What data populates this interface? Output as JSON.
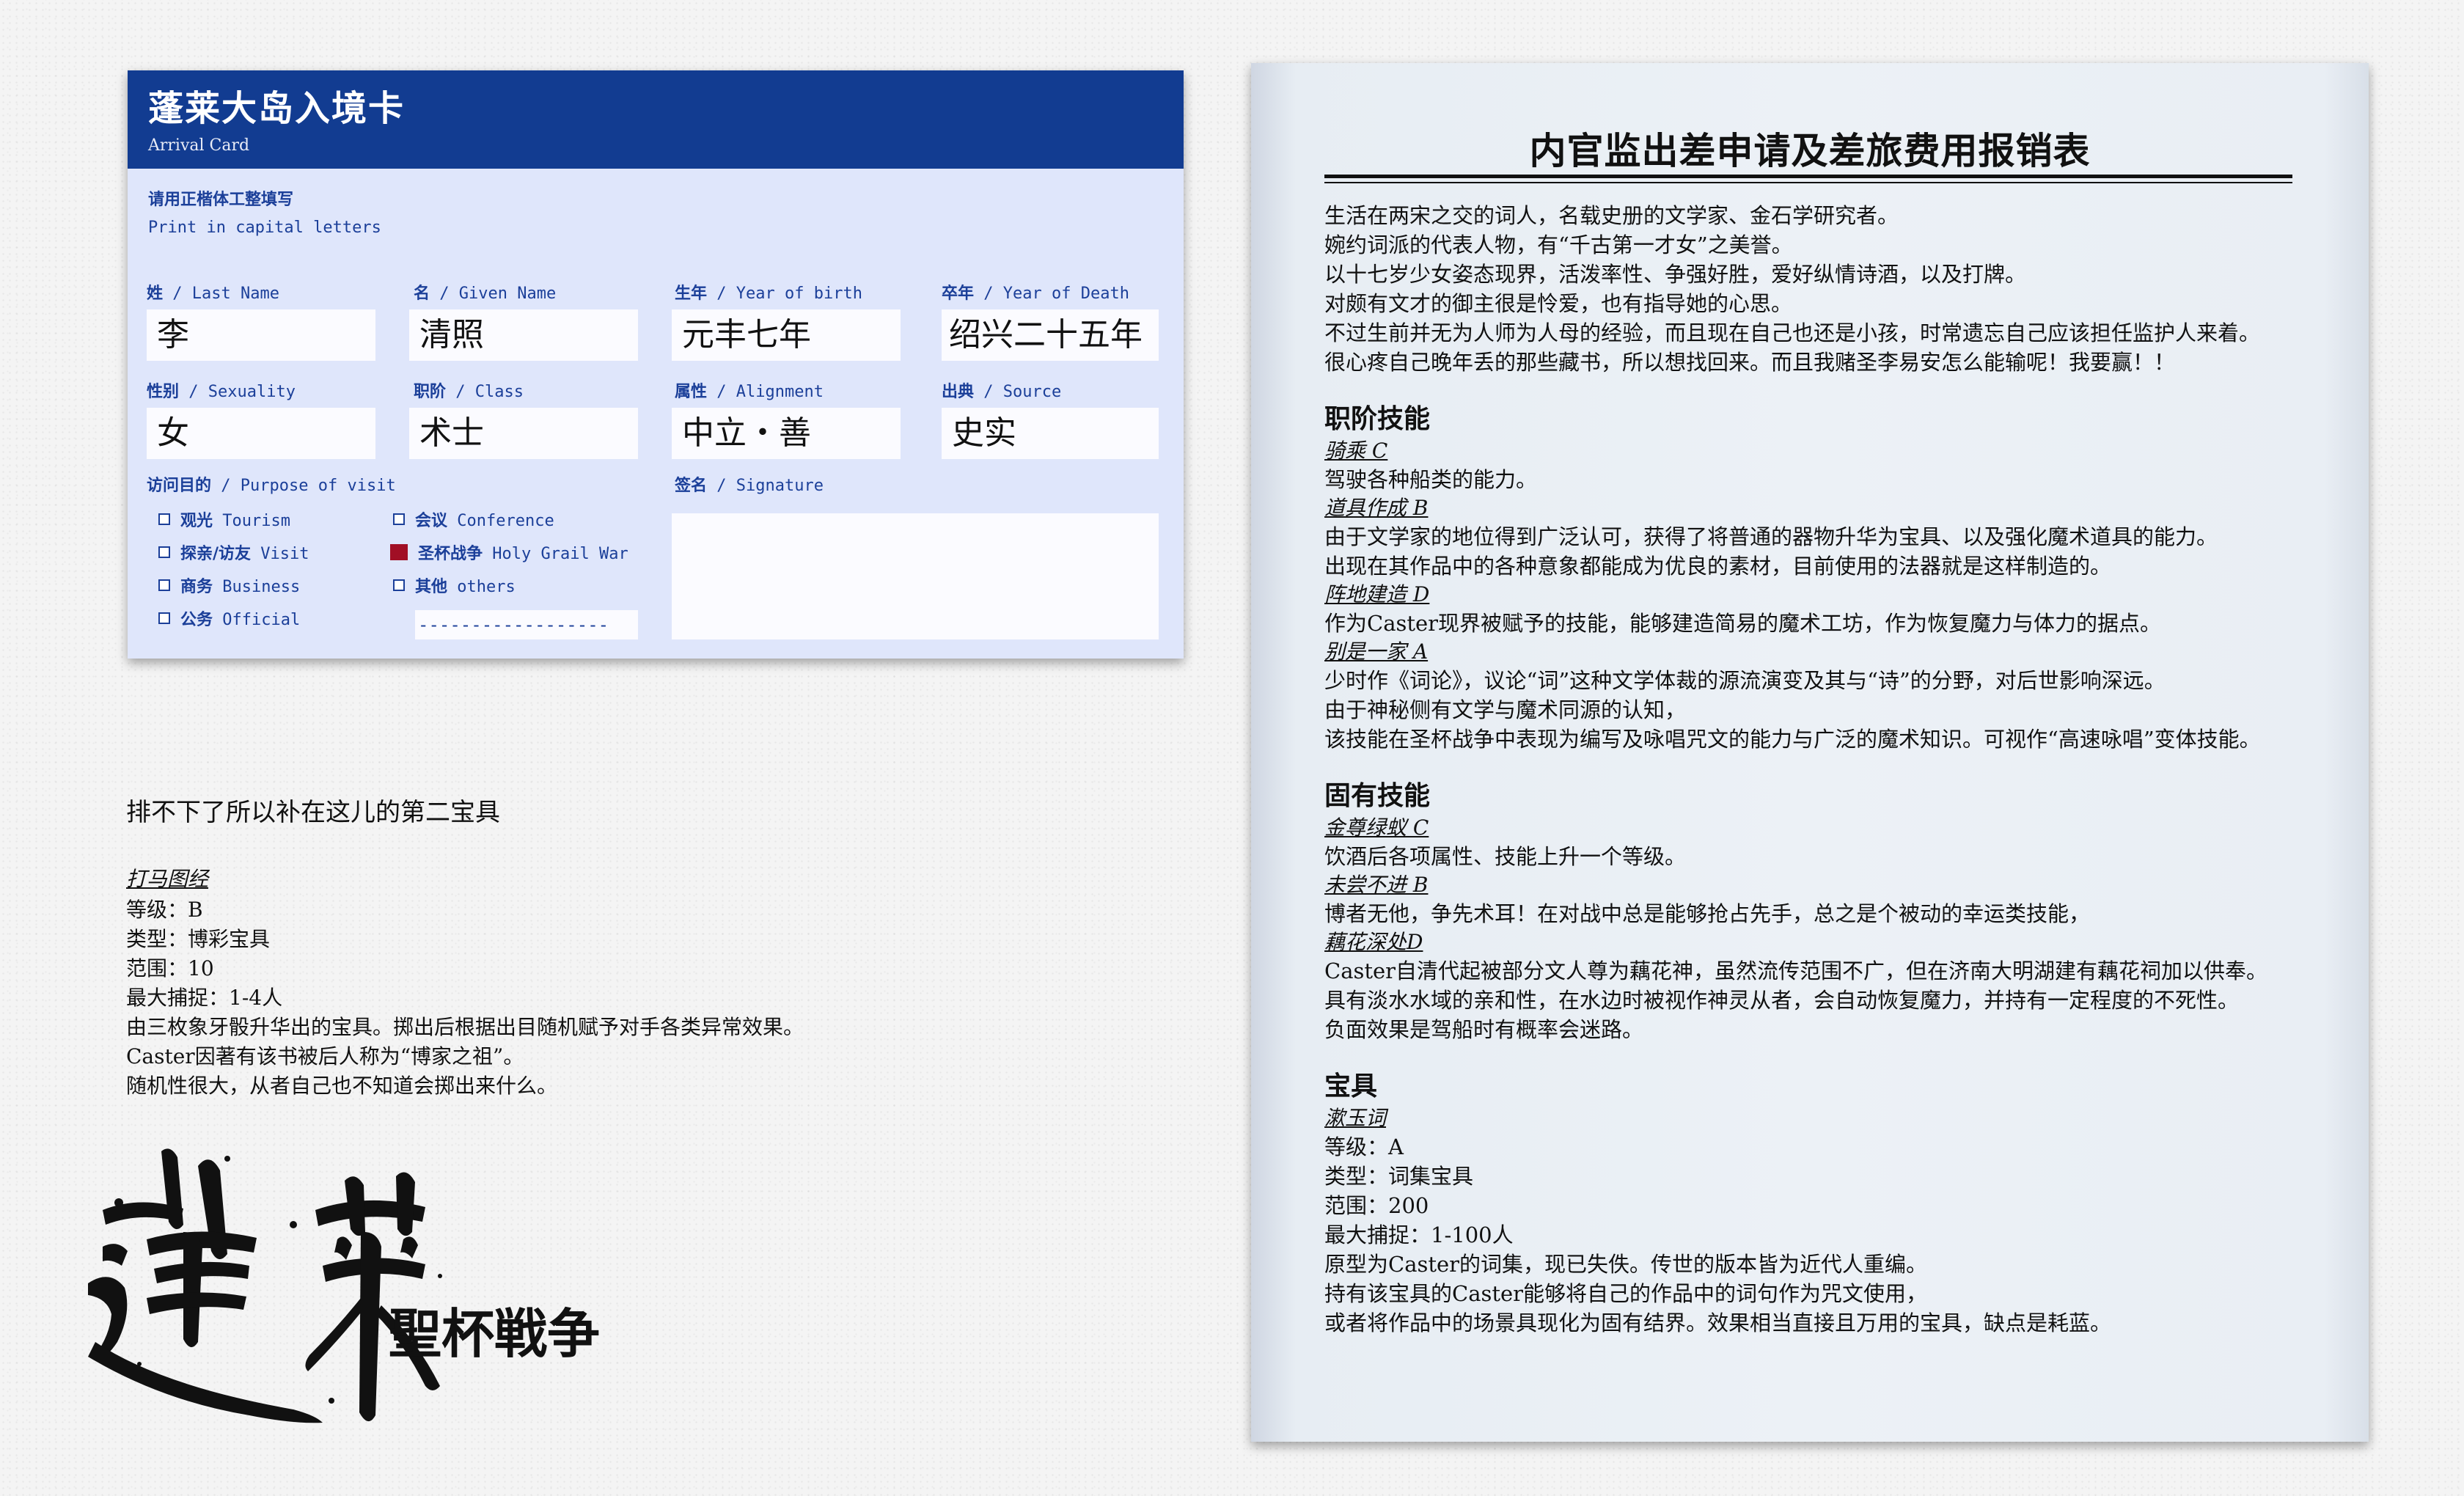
{
  "card": {
    "title": "蓬莱大岛入境卡",
    "subtitle": "Arrival Card",
    "instruction_cn": "请用正楷体工整填写",
    "instruction_en": "Print in capital letters",
    "fields": {
      "last_name": {
        "label_cn": "姓",
        "label_en": "Last Name",
        "value": "李"
      },
      "given_name": {
        "label_cn": "名",
        "label_en": "Given Name",
        "value": "清照"
      },
      "year_birth": {
        "label_cn": "生年",
        "label_en": "Year of birth",
        "value": "元丰七年"
      },
      "year_death": {
        "label_cn": "卒年",
        "label_en": "Year of Death",
        "value": "绍兴二十五年"
      },
      "sexuality": {
        "label_cn": "性别",
        "label_en": "Sexuality",
        "value": "女"
      },
      "class": {
        "label_cn": "职阶",
        "label_en": "Class",
        "value": "术士"
      },
      "alignment": {
        "label_cn": "属性",
        "label_en": "Alignment",
        "value": "中立・善"
      },
      "source": {
        "label_cn": "出典",
        "label_en": "Source",
        "value": "史实"
      }
    },
    "purpose": {
      "label_cn": "访问目的",
      "label_en": "Purpose of visit",
      "options": [
        {
          "cn": "观光",
          "en": "Tourism",
          "checked": false
        },
        {
          "cn": "探亲/访友",
          "en": "Visit",
          "checked": false
        },
        {
          "cn": "商务",
          "en": "Business",
          "checked": false
        },
        {
          "cn": "公务",
          "en": "Official",
          "checked": false
        },
        {
          "cn": "会议",
          "en": "Conference",
          "checked": false
        },
        {
          "cn": "圣杯战争",
          "en": "Holy Grail War",
          "checked": true
        },
        {
          "cn": "其他",
          "en": "others",
          "checked": false
        }
      ],
      "other_blank": "------------------"
    },
    "signature": {
      "label_cn": "签名",
      "label_en": "Signature"
    }
  },
  "notes": {
    "heading": "排不下了所以补在这儿的第二宝具",
    "np_name": "打马图经",
    "lines": [
      "等级：B",
      "类型：博彩宝具",
      "范围：10",
      "最大捕捉：1-4人",
      "由三枚象牙骰升华出的宝具。掷出后根据出目随机赋予对手各类异常效果。",
      "Caster因著有该书被后人称为“博家之祖”。",
      "随机性很大，从者自己也不知道会掷出来什么。"
    ]
  },
  "logo": {
    "calligraphy": "蓬莱",
    "text": "聖杯戦争"
  },
  "doc": {
    "title": "内官监出差申请及差旅费用报销表",
    "intro": [
      "生活在两宋之交的词人，名载史册的文学家、金石学研究者。",
      "婉约词派的代表人物，有“千古第一才女”之美誉。",
      "以十七岁少女姿态现界，活泼率性、争强好胜，爱好纵情诗酒，以及打牌。",
      "对颇有文才的御主很是怜爱，也有指导她的心思。",
      "不过生前并无为人师为人母的经验，而且现在自己也还是小孩，时常遗忘自己应该担任监护人来着。",
      "很心疼自己晚年丢的那些藏书，所以想找回来。而且我赌圣李易安怎么能输呢！我要赢！！"
    ],
    "class_skills": {
      "title": "职阶技能",
      "items": [
        {
          "name": "骑乘 C",
          "lines": [
            "驾驶各种船类的能力。"
          ]
        },
        {
          "name": "道具作成 B",
          "lines": [
            "由于文学家的地位得到广泛认可，获得了将普通的器物升华为宝具、以及强化魔术道具的能力。",
            "出现在其作品中的各种意象都能成为优良的素材，目前使用的法器就是这样制造的。"
          ]
        },
        {
          "name": "阵地建造 D",
          "lines": [
            "作为Caster现界被赋予的技能，能够建造简易的魔术工坊，作为恢复魔力与体力的据点。"
          ]
        },
        {
          "name": "别是一家 A",
          "lines": [
            "少时作《词论》，议论“词”这种文学体裁的源流演变及其与“诗”的分野，对后世影响深远。",
            "由于神秘侧有文学与魔术同源的认知，",
            "该技能在圣杯战争中表现为编写及咏唱咒文的能力与广泛的魔术知识。可视作“高速咏唱”变体技能。"
          ]
        }
      ]
    },
    "personal_skills": {
      "title": "固有技能",
      "items": [
        {
          "name": "金尊绿蚁 C",
          "lines": [
            "饮酒后各项属性、技能上升一个等级。"
          ]
        },
        {
          "name": "未尝不进 B",
          "lines": [
            "博者无他，争先术耳！在对战中总是能够抢占先手，总之是个被动的幸运类技能，"
          ]
        },
        {
          "name": "藕花深处D",
          "lines": [
            "Caster自清代起被部分文人尊为藕花神，虽然流传范围不广，但在济南大明湖建有藕花祠加以供奉。",
            "具有淡水水域的亲和性，在水边时被视作神灵从者，会自动恢复魔力，并持有一定程度的不死性。",
            "负面效果是驾船时有概率会迷路。"
          ]
        }
      ]
    },
    "noble_phantasm": {
      "title": "宝具",
      "name": "漱玉词",
      "lines": [
        "等级：A",
        "类型：词集宝具",
        "范围：200",
        "最大捕捉：1-100人",
        "原型为Caster的词集，现已失佚。传世的版本皆为近代人重编。",
        "持有该宝具的Caster能够将自己的作品中的词句作为咒文使用，",
        "或者将作品中的场景具现化为固有结界。效果相当直接且万用的宝具，缺点是耗蓝。"
      ]
    }
  },
  "colors": {
    "card_header": "#123c91",
    "card_body": "#dfe6fb",
    "card_label": "#1b3f99",
    "checked_box": "#a10f25"
  }
}
